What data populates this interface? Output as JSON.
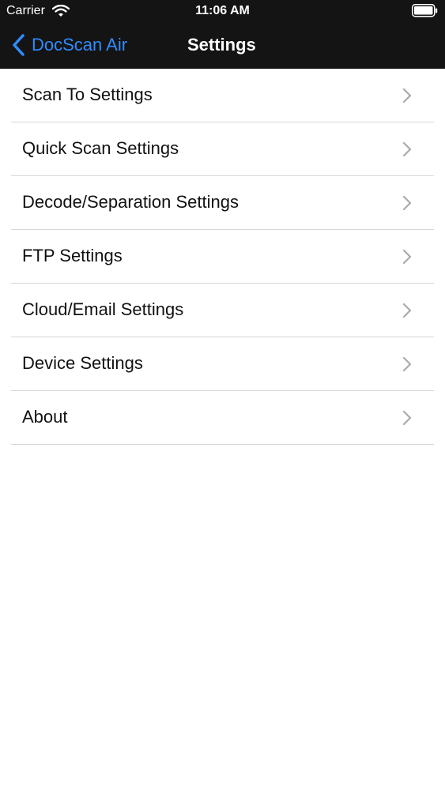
{
  "status_bar": {
    "carrier": "Carrier",
    "time": "11:06 AM"
  },
  "nav_bar": {
    "back_label": "DocScan Air",
    "title": "Settings"
  },
  "settings_items": [
    {
      "label": "Scan To Settings"
    },
    {
      "label": "Quick Scan Settings"
    },
    {
      "label": "Decode/Separation Settings"
    },
    {
      "label": "FTP Settings"
    },
    {
      "label": "Cloud/Email Settings"
    },
    {
      "label": "Device Settings"
    },
    {
      "label": "About"
    }
  ],
  "colors": {
    "nav_background": "#141414",
    "accent_blue": "#2f8cff",
    "chevron_gray": "#a9a9ae"
  },
  "icons": {
    "wifi": "wifi-icon",
    "battery": "battery-icon",
    "back": "chevron-left-icon",
    "row_disclosure": "chevron-right-icon"
  }
}
